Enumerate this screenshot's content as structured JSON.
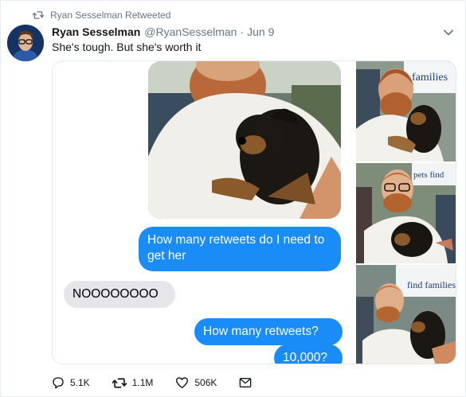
{
  "retweet_banner": {
    "text": "Ryan Sesselman Retweeted",
    "icon": "retweet-icon"
  },
  "tweet": {
    "author_name": "Ryan Sesselman",
    "author_handle": "@RyanSesselman",
    "separator": "·",
    "date": "Jun 9",
    "text": "She's tough. But she's worth it"
  },
  "chat": {
    "messages": [
      {
        "from": "me",
        "text": "How many retweets do I need to get her"
      },
      {
        "from": "them",
        "text": "NOOOOOOOO"
      },
      {
        "from": "me",
        "text": "How many retweets?"
      },
      {
        "from": "them",
        "text": "10,000?"
      }
    ]
  },
  "thumb_signs": {
    "t1": "families",
    "t2": "pets find",
    "t3": "find families"
  },
  "actions": {
    "reply_count": "5.1K",
    "retweet_count": "1.1M",
    "like_count": "506K"
  },
  "colors": {
    "accent": "#1da1f2",
    "imessage_blue": "#1a8cf7",
    "imessage_gray": "#e5e5ea",
    "muted_text": "#657786"
  }
}
